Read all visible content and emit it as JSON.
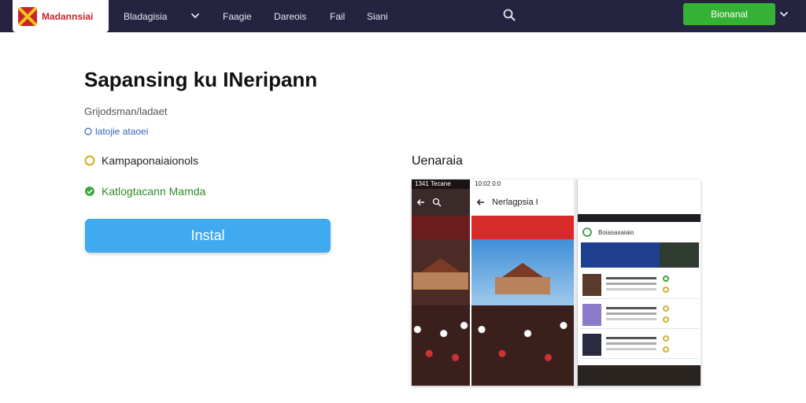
{
  "brand": {
    "name": "Madannsiai"
  },
  "nav": {
    "items": [
      "Bladagisia",
      "Faagie",
      "Dareois",
      "Fail",
      "Siani"
    ],
    "cta_label": "Bionanal"
  },
  "main": {
    "title": "Sapansing ku INeripann",
    "subtitle": "Grijodsman/ladaet",
    "meta": "latojie ataoei",
    "features": [
      "Kampaponaiaionols",
      "Katlogtacann Mamda"
    ],
    "install_label": "Instal"
  },
  "preview": {
    "label": "Uenaraia",
    "phone1": {
      "status": "1341 Tecane"
    },
    "phone2": {
      "status": "10:02 0:0",
      "title": "Nerlagpsia I"
    },
    "phone3": {
      "title": "Boiasasaiaio"
    }
  },
  "colors": {
    "nav_bg": "#262340",
    "brand_red": "#c8242b",
    "cta_green": "#34b233",
    "install_blue": "#3faaf0",
    "feature_ok": "#2f8a2b"
  }
}
